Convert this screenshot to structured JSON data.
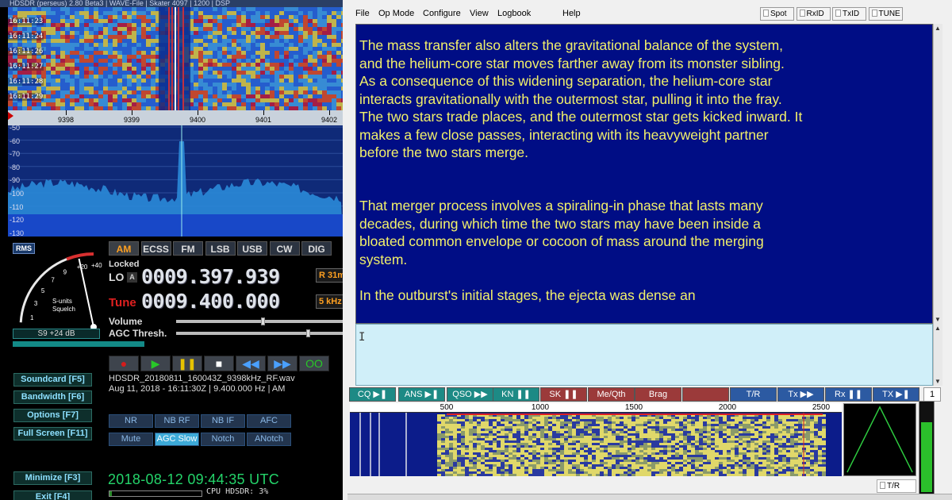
{
  "hdsdr": {
    "title": "HDSDR (perseus) 2.80 Beta3 | WAVE-File | Skater 4097 | 1200 | DSP",
    "waterfall_times": [
      "16:11:23",
      "16:11:24",
      "16:11:26",
      "16:11:27",
      "16:11:28",
      "16:11:29"
    ],
    "freq_scale": [
      "9398",
      "9399",
      "9400",
      "9401",
      "9402"
    ],
    "db_scale": [
      "-50",
      "-60",
      "-70",
      "-80",
      "-90",
      "-100",
      "-110",
      "-120",
      "-130"
    ],
    "smeter": {
      "rms": "RMS",
      "scale": [
        "1",
        "3",
        "5",
        "7",
        "9",
        "+20",
        "+40"
      ],
      "caption_line1": "S-units",
      "caption_line2": "Squelch",
      "reading": "S9 +24 dB",
      "fill_fraction": 0.86
    },
    "modes": [
      {
        "label": "AM",
        "selected": true
      },
      {
        "label": "ECSS",
        "selected": false
      },
      {
        "label": "FM",
        "selected": false
      },
      {
        "label": "LSB",
        "selected": false
      },
      {
        "label": "USB",
        "selected": false
      },
      {
        "label": "CW",
        "selected": false
      },
      {
        "label": "DIG",
        "selected": false
      }
    ],
    "locked": "Locked",
    "lo_label": "LO",
    "lo_a": "A",
    "lo_freq": "0009.397.939",
    "lo_badge": "R 31m",
    "tune_label": "Tune",
    "tune_freq": "0009.400.000",
    "tune_badge": "5 kHz",
    "volume_label": "Volume",
    "agc_label": "AGC Thresh.",
    "volume_level": 0.52,
    "agc_level": 0.8,
    "transport": [
      {
        "name": "record-button",
        "glyph": "●",
        "color": "#d41c1c"
      },
      {
        "name": "play-button",
        "glyph": "▶",
        "color": "#28c828"
      },
      {
        "name": "pause-button",
        "glyph": "❚❚",
        "color": "#e6c300"
      },
      {
        "name": "stop-button",
        "glyph": "■",
        "color": "#ffffff"
      },
      {
        "name": "rewind-button",
        "glyph": "◀◀",
        "color": "#4aa0ff"
      },
      {
        "name": "forward-button",
        "glyph": "▶▶",
        "color": "#4aa0ff"
      },
      {
        "name": "loop-button",
        "glyph": "OO",
        "color": "#28c828"
      }
    ],
    "file_line1": "HDSDR_20180811_160043Z_9398kHz_RF.wav",
    "file_line2": "Aug 11, 2018 - 16:11:30Z | 9.400.000 Hz | AM",
    "left_buttons": [
      "Soundcard [F5]",
      "Bandwidth [F6]",
      "Options  [F7]",
      "Full Screen [F11]",
      "Minimize [F3]",
      "Exit  [F4]"
    ],
    "nr_row1": [
      "NR",
      "NB RF",
      "NB IF",
      "AFC"
    ],
    "nr_row2": [
      {
        "label": "Mute",
        "on": false
      },
      {
        "label": "AGC Slow",
        "on": true
      },
      {
        "label": "Notch",
        "on": false
      },
      {
        "label": "ANotch",
        "on": false
      }
    ],
    "clock": "2018-08-12  09:44:35 UTC",
    "cpu": "CPU HDSDR: 3%",
    "cpu_fraction": 0.03
  },
  "digital": {
    "menu": [
      "File",
      "Op Mode",
      "Configure",
      "View",
      "Logbook",
      "Help"
    ],
    "toggles": [
      "Spot",
      "RxID",
      "TxID",
      "TUNE"
    ],
    "paragraphs": [
      "The mass transfer also alters the gravitational balance of the system, and the helium-core star moves farther away from its monster sibling. As a consequence of this widening separation, the helium-core star interacts gravitationally with the outermost star, pulling it into the fray. The two stars trade places, and the outermost star gets kicked inward. It makes a few close passes, interacting with its heavyweight partner before the two stars merge.",
      "That merger process involves a spiraling-in phase that lasts many decades, during which time the two stars may have been inside a bloated common envelope or cocoon of mass around the merging system.",
      "In the outburst's initial stages, the ejecta was dense an"
    ],
    "macro_buttons": [
      {
        "label": "CQ ▶❚",
        "style": "teal"
      },
      {
        "label": "ANS ▶❚",
        "style": "teal"
      },
      {
        "label": "QSO ▶▶",
        "style": "teal"
      },
      {
        "label": "KN ❚❚",
        "style": "teal"
      },
      {
        "label": "SK ❚❚",
        "style": "red"
      },
      {
        "label": "Me/Qth",
        "style": "red"
      },
      {
        "label": "Brag",
        "style": "red"
      },
      {
        "label": "",
        "style": "red"
      },
      {
        "label": "T/R",
        "style": "blue"
      },
      {
        "label": "Tx ▶▶",
        "style": "blue"
      },
      {
        "label": "Rx ❚❚",
        "style": "blue"
      },
      {
        "label": "TX ▶❚",
        "style": "blue"
      }
    ],
    "macro_counter": "1",
    "wf_axis": [
      "500",
      "1000",
      "1500",
      "2000",
      "2500"
    ],
    "tr_label": "T/R",
    "signal_level": 0.76
  }
}
